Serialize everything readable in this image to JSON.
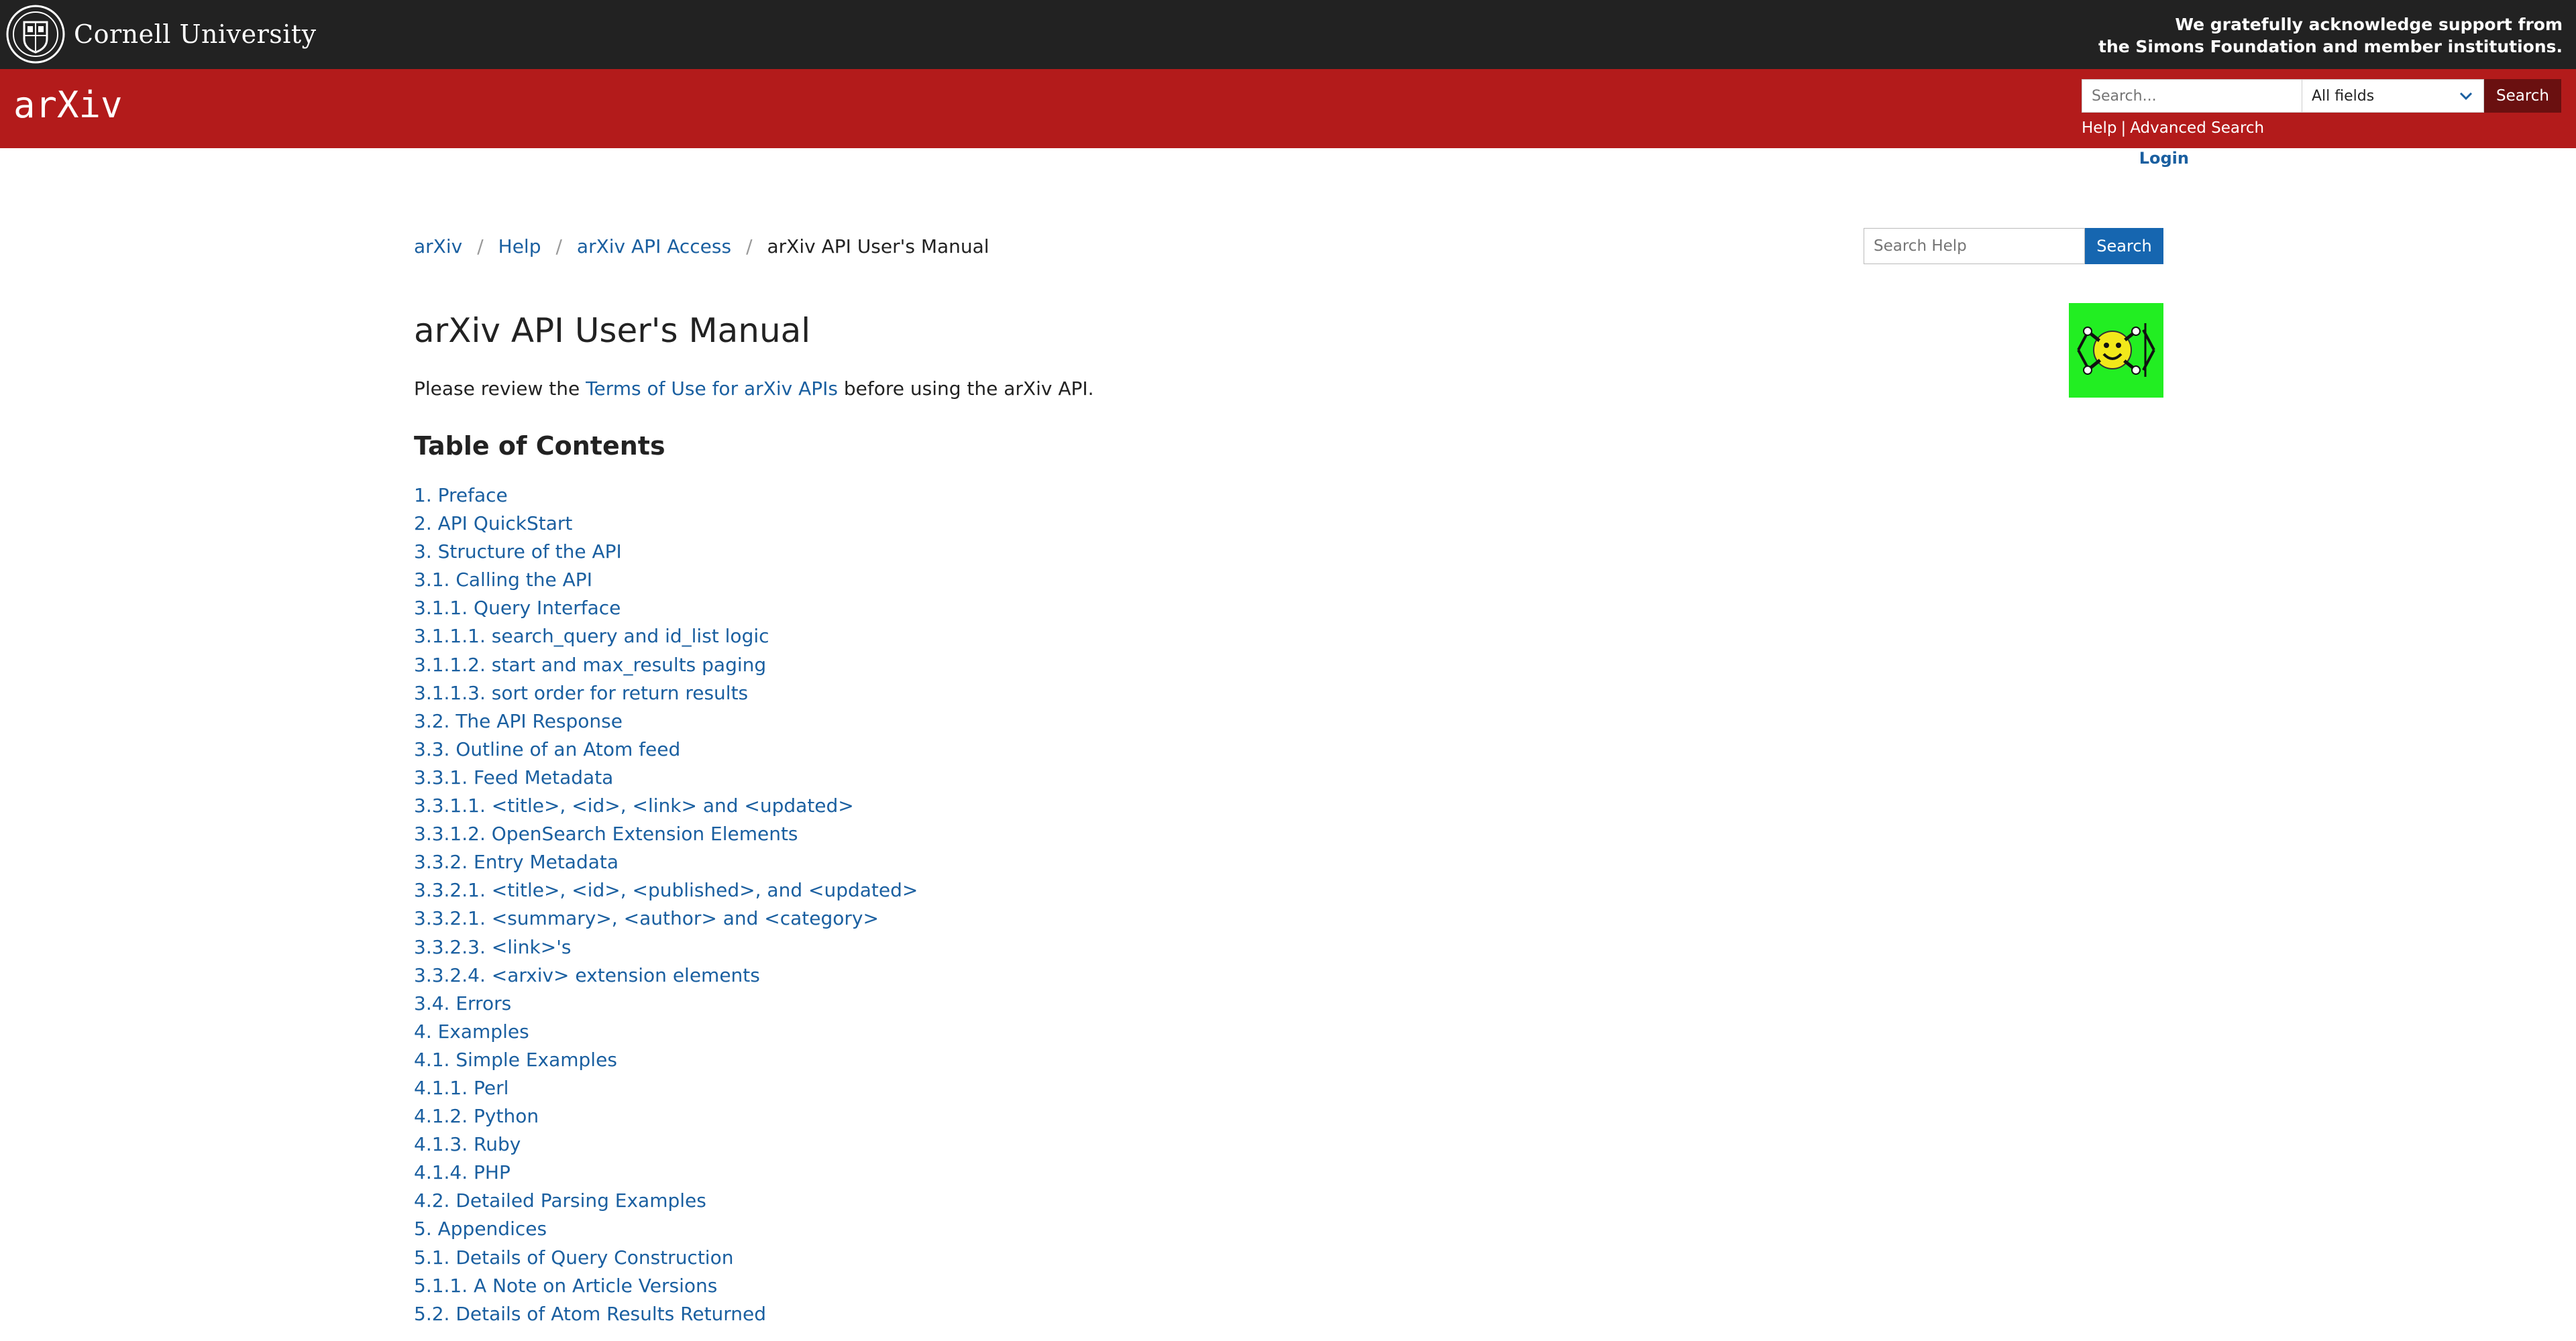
{
  "cornell": {
    "name": "Cornell University",
    "ack_line1": "We gratefully acknowledge support from",
    "ack_line2": "the Simons Foundation and member institutions."
  },
  "header": {
    "logo_text": "arXiv",
    "search_placeholder": "Search...",
    "field_selected": "All fields",
    "search_button": "Search",
    "help_link": "Help",
    "link_separator": "|",
    "advanced_search_link": "Advanced Search",
    "login": "Login"
  },
  "breadcrumb": {
    "items": [
      "arXiv",
      "Help",
      "arXiv API Access"
    ],
    "current": "arXiv API User's Manual",
    "separator": "/"
  },
  "help_search": {
    "placeholder": "Search Help",
    "button": "Search"
  },
  "page": {
    "title": "arXiv API User's Manual",
    "intro_before": "Please review the ",
    "intro_link": "Terms of Use for arXiv APIs",
    "intro_after": " before using the arXiv API.",
    "toc_title": "Table of Contents"
  },
  "toc": [
    "1. Preface",
    "2. API QuickStart",
    "3. Structure of the API",
    "3.1. Calling the API",
    "3.1.1. Query Interface",
    "3.1.1.1. search_query and id_list logic",
    "3.1.1.2. start and max_results paging",
    "3.1.1.3. sort order for return results",
    "3.2. The API Response",
    "3.3. Outline of an Atom feed",
    "3.3.1. Feed Metadata",
    "3.3.1.1. <title>, <id>, <link> and <updated>",
    "3.3.1.2. OpenSearch Extension Elements",
    "3.3.2. Entry Metadata",
    "3.3.2.1. <title>, <id>, <published>, and <updated>",
    "3.3.2.1. <summary>, <author> and <category>",
    "3.3.2.3. <link>'s",
    "3.3.2.4. <arxiv> extension elements",
    "3.4. Errors",
    "4. Examples",
    "4.1. Simple Examples",
    "4.1.1. Perl",
    "4.1.2. Python",
    "4.1.3. Ruby",
    "4.1.4. PHP",
    "4.2. Detailed Parsing Examples",
    "5. Appendices",
    "5.1. Details of Query Construction",
    "5.1.1. A Note on Article Versions",
    "5.2. Details of Atom Results Returned"
  ],
  "colors": {
    "cornell_bar": "#222222",
    "header_red": "#b31b1b",
    "link_blue": "#1a5fa0",
    "help_button": "#1666b0",
    "search_button": "#6a1010",
    "api_logo_bg": "#22ee22",
    "smiley": "#f2e81a"
  },
  "icons": {
    "cornell_seal": "cornell-seal-icon",
    "api_logo": "api-smiley-logo",
    "dropdown": "chevron-down-icon"
  }
}
